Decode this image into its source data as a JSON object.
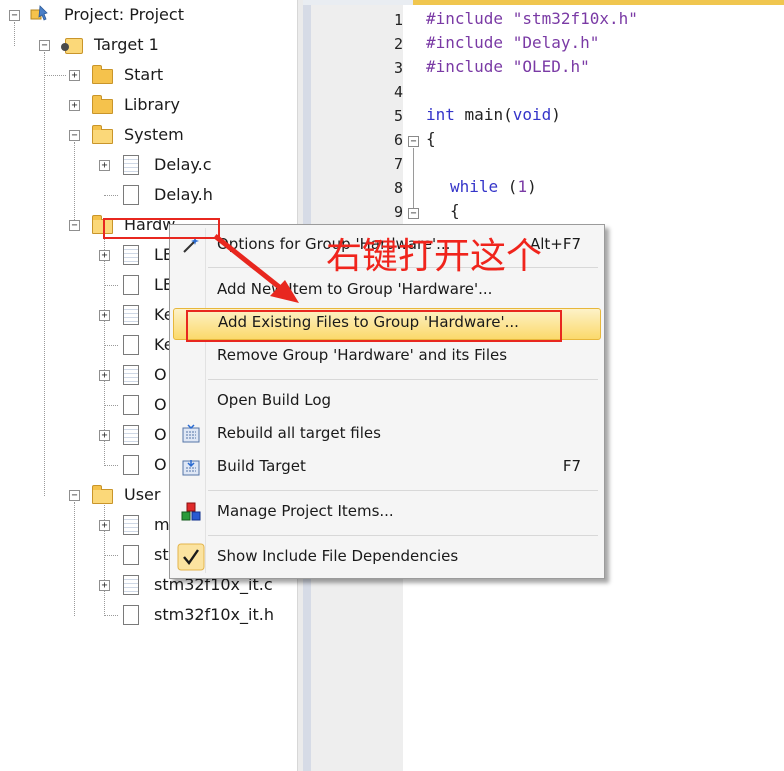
{
  "tree": {
    "project": "Project: Project",
    "target": "Target 1",
    "groups": [
      {
        "label": "Start"
      },
      {
        "label": "Library"
      },
      {
        "label": "System"
      },
      {
        "label": "Hardw"
      },
      {
        "label": "User"
      }
    ],
    "system_files": [
      "Delay.c",
      "Delay.h"
    ],
    "hardware_files": [
      "LE",
      "LE",
      "Ke",
      "Ke",
      "O",
      "O",
      "O",
      "O"
    ],
    "user_files": [
      "m",
      "st",
      "stm32f10x_it.c",
      "stm32f10x_it.h"
    ]
  },
  "editor": {
    "line_numbers": [
      "1",
      "2",
      "3",
      "4",
      "5",
      "6",
      "7",
      "8",
      "9"
    ],
    "include_keyword": "#include",
    "include_files": [
      "\"stm32f10x.h\"",
      "\"Delay.h\"",
      "\"OLED.h\""
    ],
    "line5": {
      "kw": "int",
      "fn": "main(",
      "param": "void",
      "close": ")"
    },
    "line6": "{",
    "line8": {
      "kw": "while",
      "open": " (",
      "num": "1",
      "close": ")"
    },
    "line9": "{"
  },
  "context_menu": {
    "items": [
      {
        "label": "Options for Group 'Hardware'...",
        "shortcut": "Alt+F7",
        "icon": "options-wand-icon"
      },
      {
        "label": "Add New  Item to Group 'Hardware'...",
        "shortcut": ""
      },
      {
        "label": "Add Existing Files to Group 'Hardware'...",
        "shortcut": "",
        "highlighted": true
      },
      {
        "label": "Remove Group 'Hardware' and its Files",
        "shortcut": ""
      },
      {
        "label": "Open Build Log",
        "shortcut": ""
      },
      {
        "label": "Rebuild all target files",
        "shortcut": "",
        "icon": "rebuild-icon"
      },
      {
        "label": "Build Target",
        "shortcut": "F7",
        "icon": "build-icon"
      },
      {
        "label": "Manage Project Items...",
        "shortcut": "",
        "icon": "manage-items-icon"
      },
      {
        "label": "Show Include File Dependencies",
        "shortcut": "",
        "icon": "checkmark-icon"
      }
    ]
  },
  "annotation": {
    "text": "右键打开这个",
    "color": "#f0241c"
  },
  "colors": {
    "highlight": "#fbd96b",
    "keyword": "#3535c9",
    "preprocessor": "#7a3aa5",
    "annotation_red": "#e8271f"
  }
}
